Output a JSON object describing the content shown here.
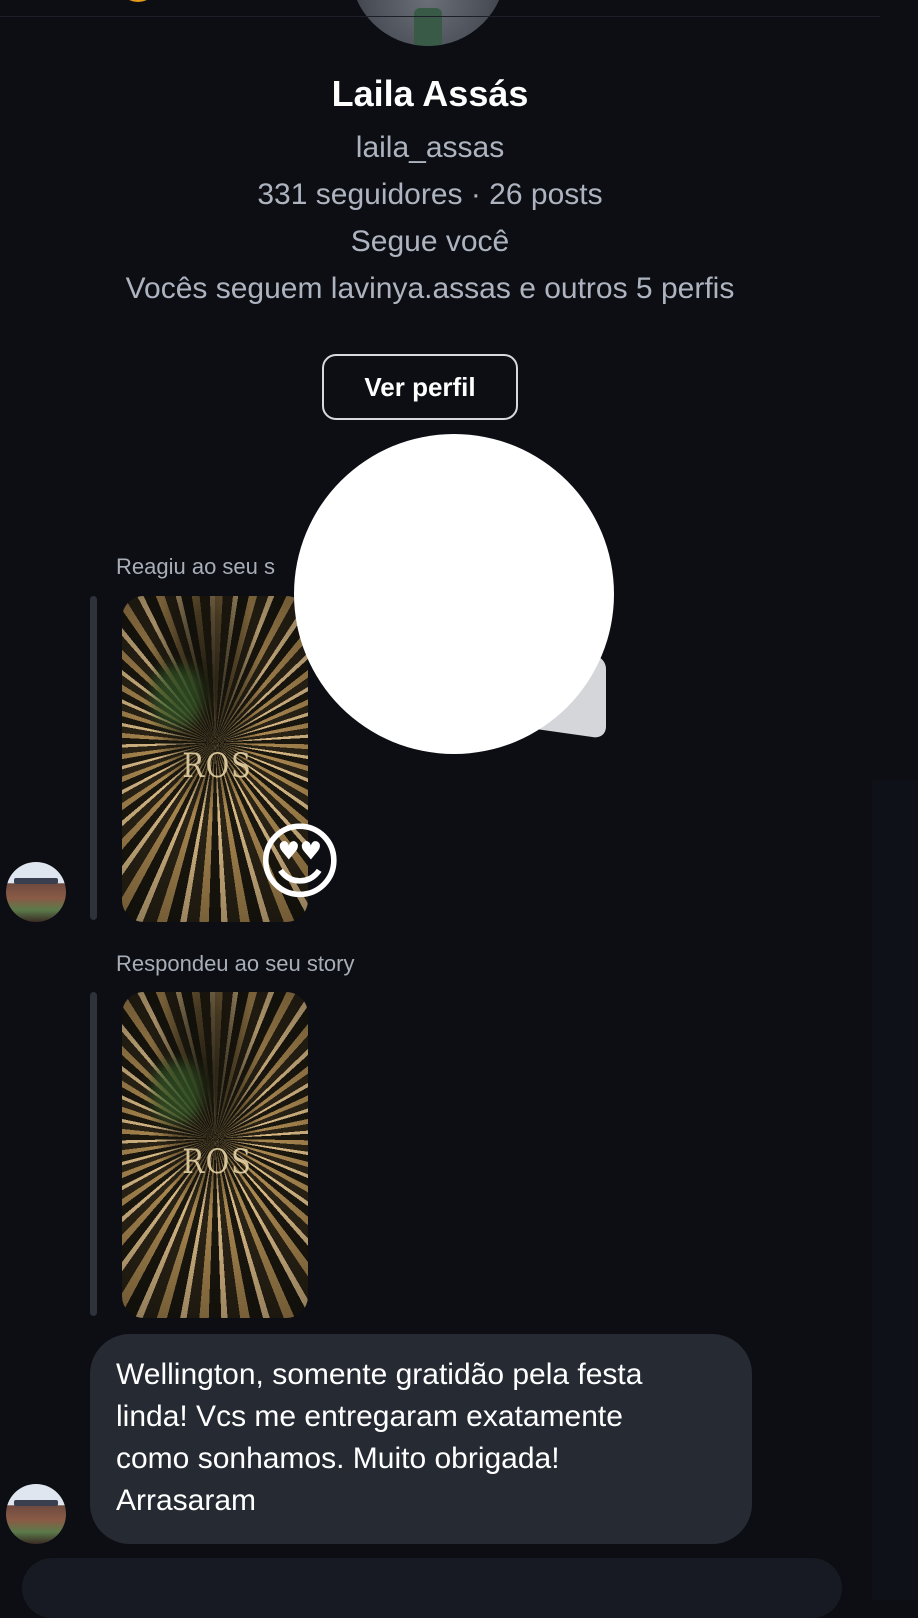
{
  "profile": {
    "name": "Laila Assás",
    "username": "laila_assas",
    "stats": "331 seguidores · 26 posts",
    "follows_you": "Segue você",
    "mutual": "Vocês seguem lavinya.assas e outros 5 perfis",
    "view_profile_button": "Ver perfil"
  },
  "messages": [
    {
      "label": "Reagiu ao seu story",
      "label_visible": "Reagiu ao seu s",
      "story_thumb_text": "ROS",
      "reaction": "😍"
    },
    {
      "label": "Respondeu ao seu story",
      "story_thumb_text": "ROS"
    },
    {
      "text": "Wellington, somente gratidão pela festa\nlinda! Vcs me entregaram exatamente\ncomo sonhamos. Muito obrigada!\nArrasaram"
    }
  ],
  "reaction_popup": {
    "emoji": "😍"
  },
  "colors": {
    "background": "#0c0e14",
    "bubble": "#262a33",
    "secondary_text": "#aeb4bf",
    "accent_badge": "#e59a1a"
  }
}
